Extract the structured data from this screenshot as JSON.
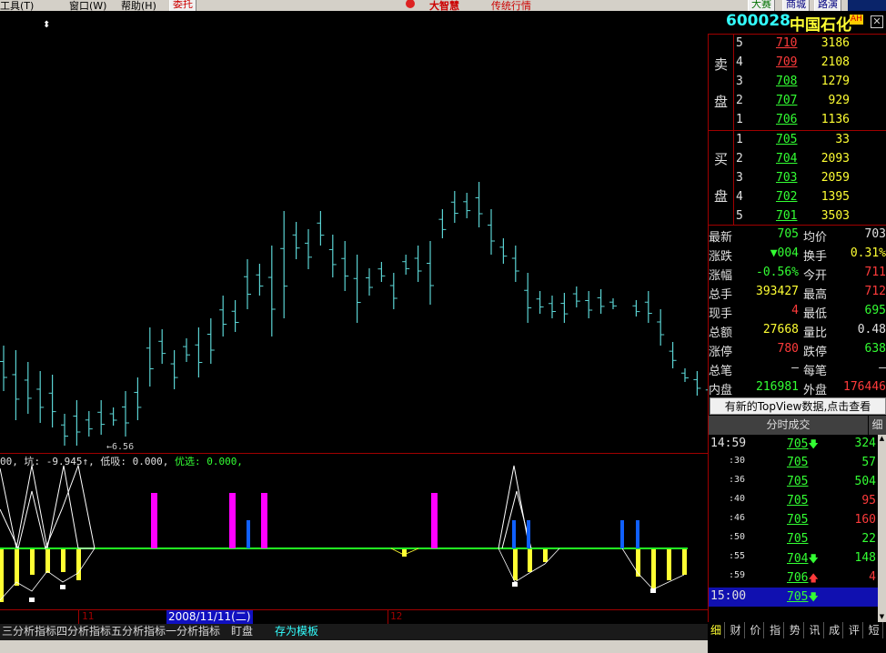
{
  "menu": {
    "items": [
      "工具(T)",
      "窗口(W)",
      "帮助(H)"
    ],
    "entrust": "委托",
    "brand": "大智慧",
    "brand_sub": "传统行情",
    "right_buttons": [
      "大赛",
      "商城",
      "路演"
    ]
  },
  "stock": {
    "code": "600028",
    "name": "中国石化",
    "badge": "AH"
  },
  "sell_side_label": [
    "卖",
    "盘"
  ],
  "buy_side_label": [
    "买",
    "盘"
  ],
  "asks": [
    {
      "level": "5",
      "price": "710",
      "volume": "3186"
    },
    {
      "level": "4",
      "price": "709",
      "volume": "2108"
    },
    {
      "level": "3",
      "price": "708",
      "volume": "1279"
    },
    {
      "level": "2",
      "price": "707",
      "volume": "929"
    },
    {
      "level": "1",
      "price": "706",
      "volume": "1136"
    }
  ],
  "bids": [
    {
      "level": "1",
      "price": "705",
      "volume": "33"
    },
    {
      "level": "2",
      "price": "704",
      "volume": "2093"
    },
    {
      "level": "3",
      "price": "703",
      "volume": "2059"
    },
    {
      "level": "4",
      "price": "702",
      "volume": "1395"
    },
    {
      "level": "5",
      "price": "701",
      "volume": "3503"
    }
  ],
  "quote": [
    {
      "l1": "最新",
      "v1": "705",
      "l2": "均价",
      "v2": "703",
      "c1": "green",
      "c2": "white"
    },
    {
      "l1": "涨跌",
      "v1": "▼004",
      "l2": "换手",
      "v2": "0.31%",
      "c1": "green",
      "c2": "yellow"
    },
    {
      "l1": "涨幅",
      "v1": "-0.56%",
      "l2": "今开",
      "v2": "711",
      "c1": "green",
      "c2": "red"
    },
    {
      "l1": "总手",
      "v1": "393427",
      "l2": "最高",
      "v2": "712",
      "c1": "yellow",
      "c2": "red"
    },
    {
      "l1": "现手",
      "v1": "4",
      "l2": "最低",
      "v2": "695",
      "c1": "red",
      "c2": "green"
    },
    {
      "l1": "总额",
      "v1": "27668",
      "l2": "量比",
      "v2": "0.48",
      "c1": "yellow",
      "c2": "white"
    },
    {
      "l1": "涨停",
      "v1": "780",
      "l2": "跌停",
      "v2": "638",
      "c1": "red",
      "c2": "green"
    },
    {
      "l1": "总笔",
      "v1": "–",
      "l2": "每笔",
      "v2": "–",
      "c1": "white",
      "c2": "white"
    },
    {
      "l1": "内盘",
      "v1": "216981",
      "l2": "外盘",
      "v2": "176446",
      "c1": "green",
      "c2": "red"
    }
  ],
  "topview_notice": "有新的TopView数据,点击查看",
  "ticks_header": "分时成交",
  "ticks_header_right": "细",
  "ticks": [
    {
      "time": "14:59",
      "price": "705",
      "arrow": "down",
      "vol": "324",
      "vc": "green"
    },
    {
      "time": ":30",
      "price": "705",
      "arrow": "",
      "vol": "57",
      "vc": "green"
    },
    {
      "time": ":36",
      "price": "705",
      "arrow": "",
      "vol": "504",
      "vc": "green"
    },
    {
      "time": ":40",
      "price": "705",
      "arrow": "",
      "vol": "95",
      "vc": "red"
    },
    {
      "time": ":46",
      "price": "705",
      "arrow": "",
      "vol": "160",
      "vc": "red"
    },
    {
      "time": ":50",
      "price": "705",
      "arrow": "",
      "vol": "22",
      "vc": "green"
    },
    {
      "time": ":55",
      "price": "704",
      "arrow": "down",
      "vol": "148",
      "vc": "green"
    },
    {
      "time": ":59",
      "price": "706",
      "arrow": "up",
      "vol": "4",
      "vc": "red"
    },
    {
      "time": "15:00",
      "price": "705",
      "arrow": "down",
      "vol": "",
      "vc": "green"
    }
  ],
  "side_tabs": [
    "细",
    "财",
    "价",
    "指",
    "势",
    "讯",
    "成",
    "评",
    "短"
  ],
  "indicator_text": {
    "part1": "00, 坑: -9.945↑, 低吸: 0.000, ",
    "part2": "优选: 0.000,"
  },
  "price_low_label": "←6.56",
  "date_labels": {
    "month1": "11",
    "selected": "2008/11/11(二)",
    "month2": "12"
  },
  "bottom_tabs": [
    "三分析指标",
    "四分析指标",
    "五分析指标",
    "一分析指标",
    "盯盘",
    "存为模板"
  ],
  "colors": {
    "candle": "#5ad2d2",
    "baseline": "#22ff22",
    "magenta": "#ff00ff",
    "blue": "#1060ff",
    "yellow": "#ffff33",
    "grid_red": "#a00000"
  }
}
